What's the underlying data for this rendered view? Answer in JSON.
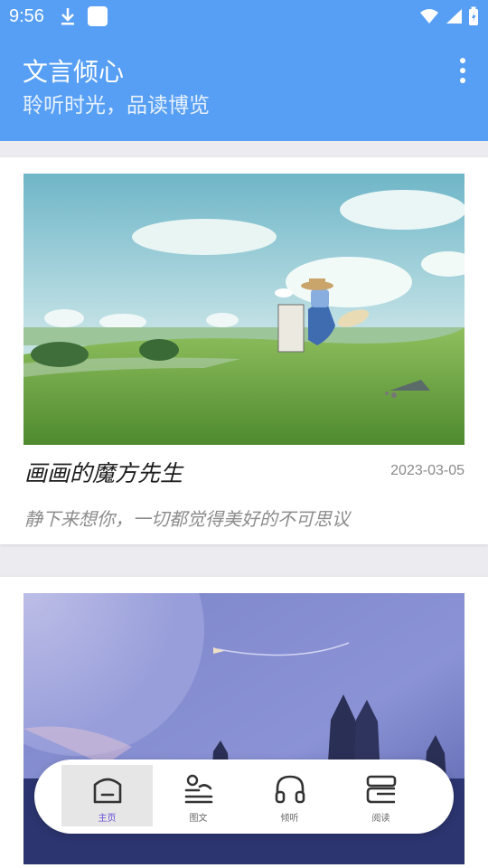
{
  "status_bar": {
    "time": "9:56"
  },
  "header": {
    "title": "文言倾心",
    "subtitle": "聆听时光，品读博览",
    "menu_icon": "more-vert-icon"
  },
  "cards": [
    {
      "title": "画画的魔方先生",
      "date": "2023-03-05",
      "description": "静下来想你，一切都觉得美好的不可思议"
    },
    {
      "title": "",
      "date": "",
      "description": ""
    }
  ],
  "bottom_nav": {
    "items": [
      {
        "label": "主页",
        "icon": "home-icon",
        "active": true
      },
      {
        "label": "图文",
        "icon": "image-text-icon",
        "active": false
      },
      {
        "label": "倾听",
        "icon": "headphones-icon",
        "active": false
      },
      {
        "label": "阅读",
        "icon": "book-icon",
        "active": false
      }
    ]
  },
  "colors": {
    "primary": "#579ff4",
    "accent": "#6a4fd6"
  }
}
